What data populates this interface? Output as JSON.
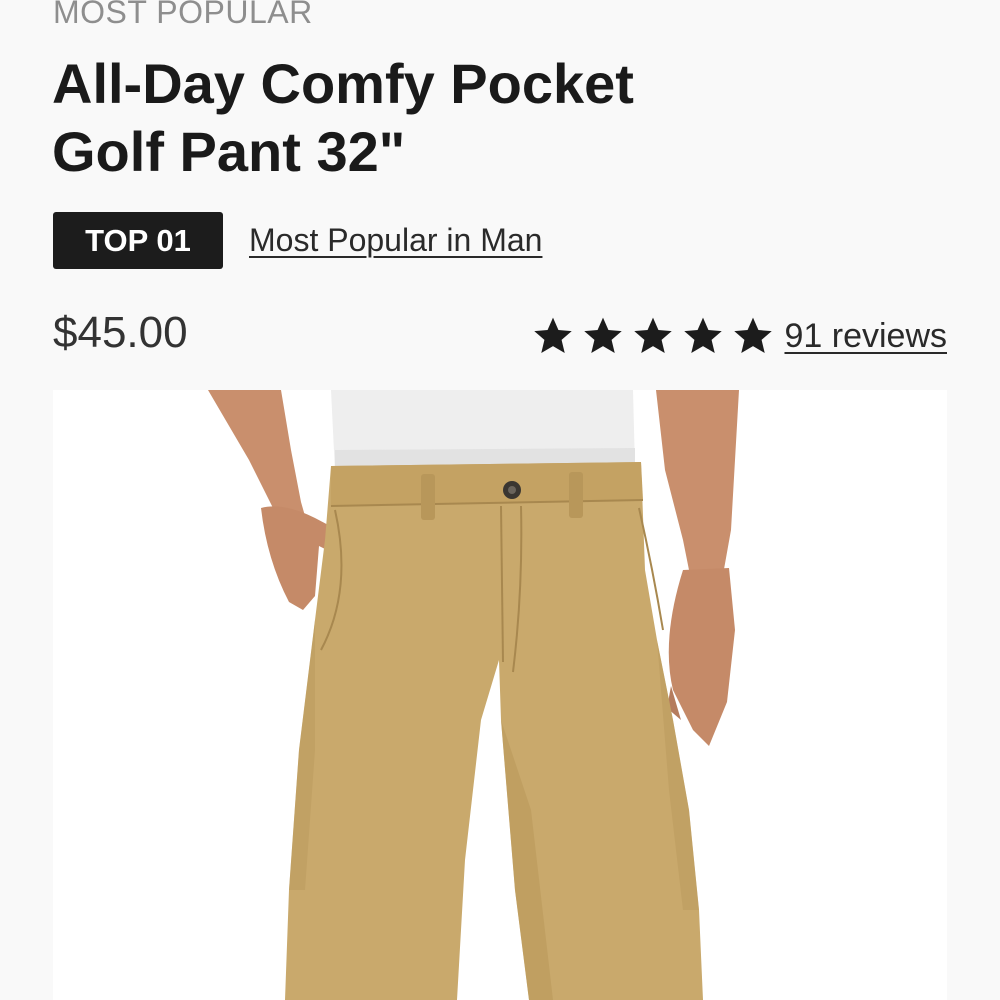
{
  "product": {
    "eyebrow": "MOST POPULAR",
    "title": "All-Day Comfy Pocket Golf Pant 32\"",
    "rank_badge": "TOP 01",
    "rank_link": "Most Popular in Man",
    "price": "$45.00",
    "rating": {
      "stars": 5,
      "reviews_label": "91 reviews"
    },
    "image": {
      "alt": "Khaki golf pants worn with white tucked shirt",
      "pant_color": "#c9a96c",
      "shirt_color": "#eeeeee",
      "skin_color": "#c98f6d"
    }
  },
  "colors": {
    "background": "#f9f9f9",
    "text": "#1c1c1c",
    "muted": "#8e8e8e",
    "badge_bg": "#1c1c1c",
    "badge_text": "#ffffff",
    "star": "#1c1c1c"
  }
}
